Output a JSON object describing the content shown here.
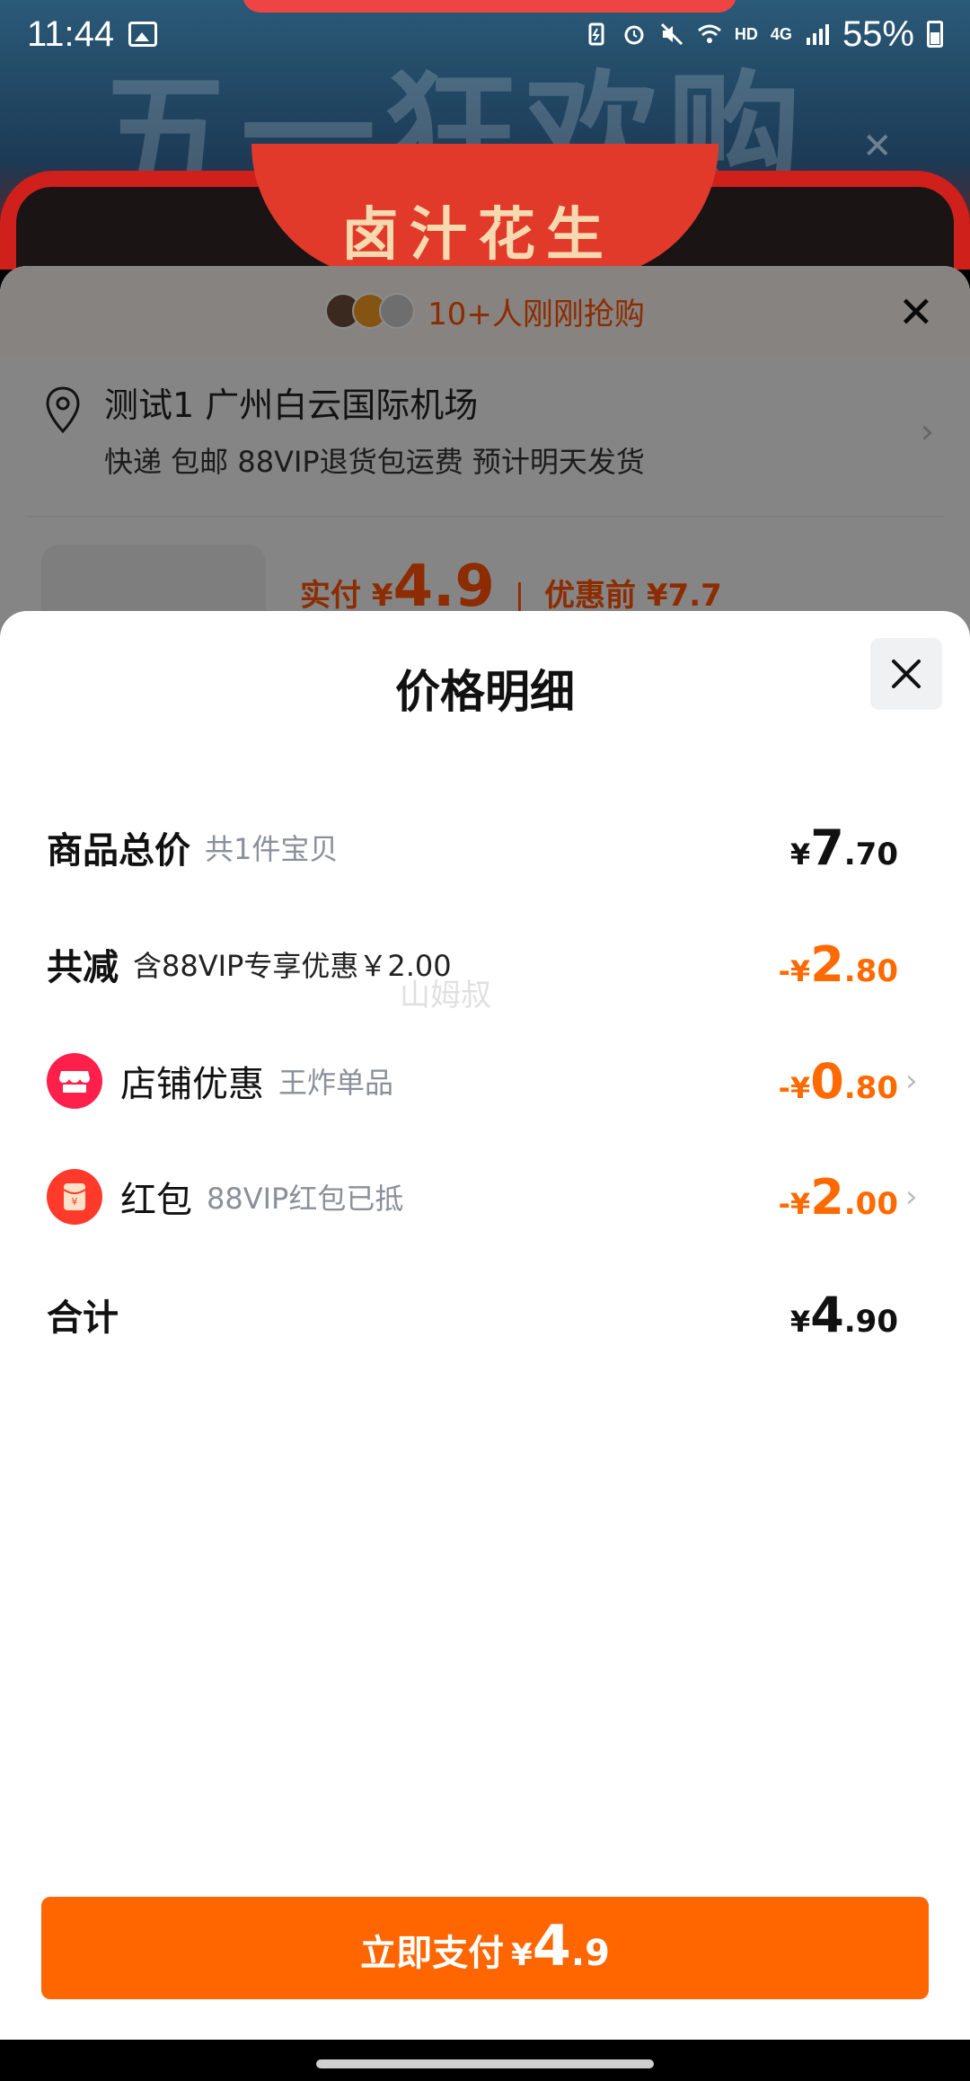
{
  "status_bar": {
    "time": "11:44",
    "network": "4G",
    "hd": "HD",
    "battery": "55%"
  },
  "background_page": {
    "banner_text": "五一狂欢购",
    "oval_text": "卤汁花生"
  },
  "order_sheet": {
    "buyers_text": "10+人刚刚抢购",
    "address_line1": "测试1 广州白云国际机场",
    "address_line2": "快递 包邮 88VIP退货包运费 预计明天发货",
    "price_label": "实付",
    "price_currency": "¥",
    "price_value": "4.9",
    "separator": "|",
    "before_label": "优惠前",
    "before_value": "¥7.7"
  },
  "price_detail": {
    "title": "价格明细",
    "rows": [
      {
        "label": "商品总价",
        "sub": "共1件宝贝",
        "currency": "¥",
        "int": "7",
        "dec": ".70"
      },
      {
        "label": "共减",
        "sub": "含88VIP专享优惠￥2.00",
        "currency": "-¥",
        "int": "2",
        "dec": ".80"
      },
      {
        "label": "店铺优惠",
        "sub": "王炸单品",
        "currency": "-¥",
        "int": "0",
        "dec": ".80"
      },
      {
        "label": "红包",
        "sub": "88VIP红包已抵",
        "currency": "-¥",
        "int": "2",
        "dec": ".00"
      },
      {
        "label": "合计",
        "currency": "¥",
        "int": "4",
        "dec": ".90"
      }
    ],
    "watermark": "山姆叔",
    "pay_button": {
      "label": "立即支付",
      "currency": "¥",
      "int": "4",
      "dec": ".9"
    }
  },
  "colors": {
    "accent": "#ff6600",
    "discount": "#ff6a00",
    "shop_icon": "#ff1f4b",
    "redbag_icon": "#ff3a2a"
  }
}
